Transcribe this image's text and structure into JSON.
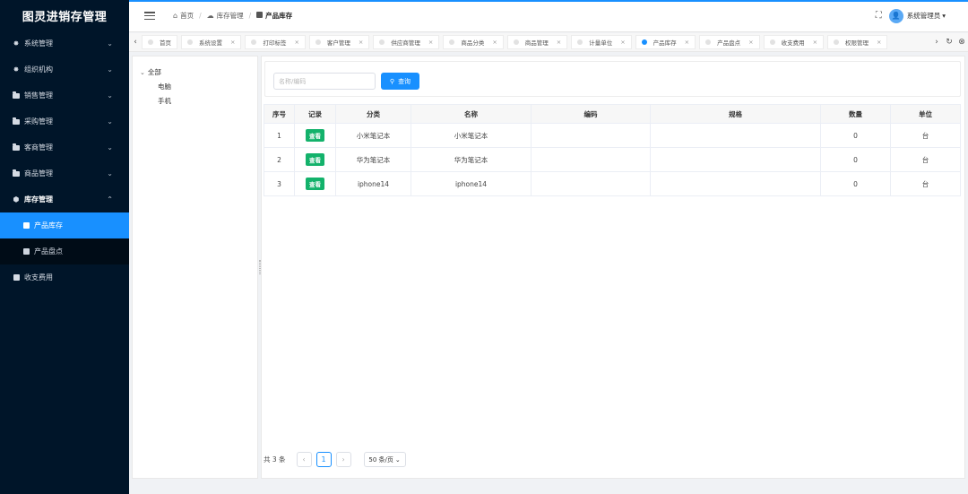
{
  "app": {
    "title": "图灵进销存管理"
  },
  "sidebar": {
    "items": [
      {
        "label": "系统管理",
        "icon": "gear-icon",
        "chevron": "⌄"
      },
      {
        "label": "组织机构",
        "icon": "gear-icon",
        "chevron": "⌄"
      },
      {
        "label": "销售管理",
        "icon": "folder-icon",
        "chevron": "⌄"
      },
      {
        "label": "采购管理",
        "icon": "folder-icon",
        "chevron": "⌄"
      },
      {
        "label": "客商管理",
        "icon": "folder-icon",
        "chevron": "⌄"
      },
      {
        "label": "商品管理",
        "icon": "folder-icon",
        "chevron": "⌄"
      },
      {
        "label": "库存管理",
        "icon": "cube-icon",
        "chevron": "⌃"
      }
    ],
    "sub_items": [
      {
        "label": "产品库存",
        "icon": "document-icon"
      },
      {
        "label": "产品盘点",
        "icon": "document-icon"
      }
    ],
    "last_item": {
      "label": "收支费用",
      "icon": "document-icon"
    }
  },
  "header": {
    "breadcrumb": {
      "home": "首页",
      "parent": "库存管理",
      "current": "产品库存"
    },
    "user": "系统管理员",
    "user_caret": "▾"
  },
  "tabs": [
    {
      "label": "首页",
      "closable": false
    },
    {
      "label": "系统设置",
      "closable": true
    },
    {
      "label": "打印标签",
      "closable": true
    },
    {
      "label": "客户管理",
      "closable": true
    },
    {
      "label": "供应商管理",
      "closable": true
    },
    {
      "label": "商品分类",
      "closable": true
    },
    {
      "label": "商品管理",
      "closable": true
    },
    {
      "label": "计量单位",
      "closable": true
    },
    {
      "label": "产品库存",
      "closable": true,
      "active": true
    },
    {
      "label": "产品盘点",
      "closable": true
    },
    {
      "label": "收支费用",
      "closable": true
    },
    {
      "label": "权限管理",
      "closable": true
    }
  ],
  "tree": {
    "root": "全部",
    "children": [
      "电脑",
      "手机"
    ]
  },
  "search": {
    "placeholder": "名称/编码",
    "value": "",
    "button": "查询"
  },
  "table": {
    "columns": [
      "序号",
      "记录",
      "分类",
      "名称",
      "编码",
      "规格",
      "数量",
      "单位"
    ],
    "rows": [
      {
        "index": "1",
        "record": "查看",
        "category": "小米笔记本",
        "name": "小米笔记本",
        "code": "",
        "spec": "",
        "qty": "0",
        "unit": "台"
      },
      {
        "index": "2",
        "record": "查看",
        "category": "华为笔记本",
        "name": "华为笔记本",
        "code": "",
        "spec": "",
        "qty": "0",
        "unit": "台"
      },
      {
        "index": "3",
        "record": "查看",
        "category": "iphone14",
        "name": "iphone14",
        "code": "",
        "spec": "",
        "qty": "0",
        "unit": "台"
      }
    ]
  },
  "pagination": {
    "total": "共 3 条",
    "current_page": "1",
    "prev": "‹",
    "next": "›",
    "page_size": "50 条/页"
  },
  "colors": {
    "accent": "#1890ff",
    "sidebar_bg": "#001529",
    "tag_green": "#13b26b"
  }
}
